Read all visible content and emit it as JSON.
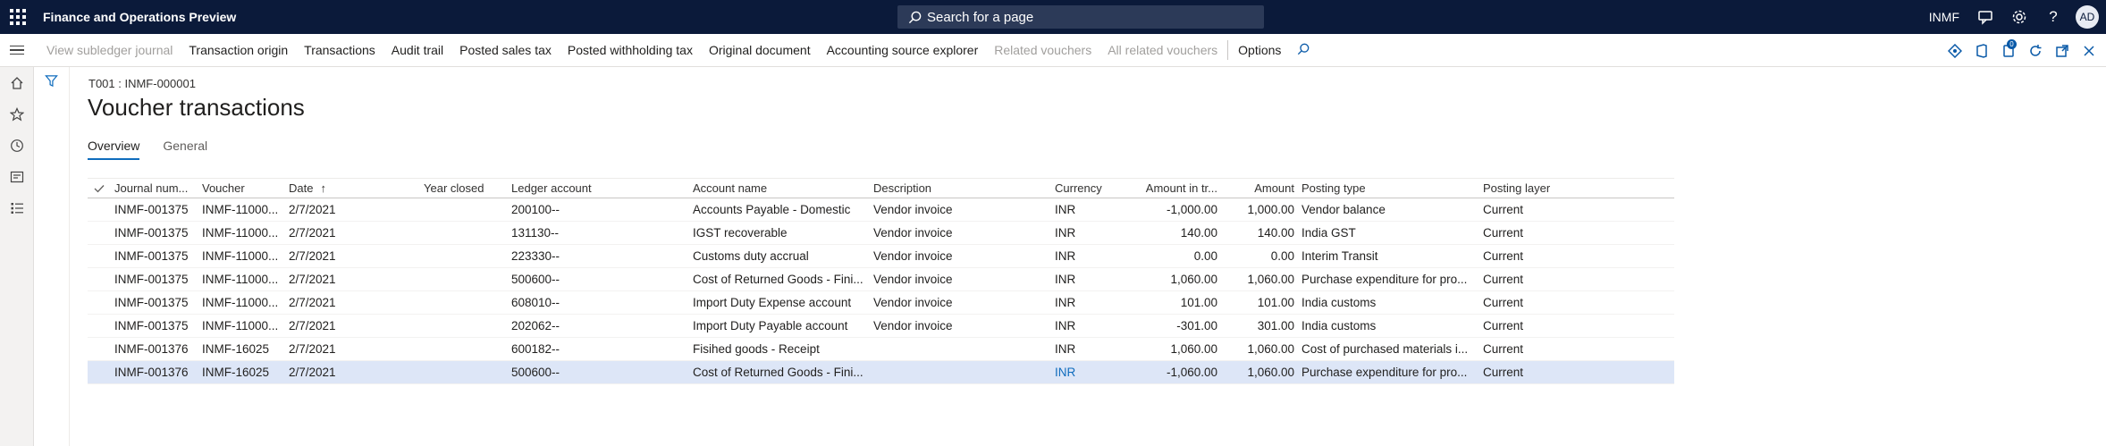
{
  "app": {
    "title": "Finance and Operations Preview",
    "search_placeholder": "Search for a page",
    "company": "INMF",
    "user_initials": "AD"
  },
  "actions": {
    "items": [
      {
        "label": "View subledger journal",
        "disabled": true
      },
      {
        "label": "Transaction origin",
        "disabled": false
      },
      {
        "label": "Transactions",
        "disabled": false
      },
      {
        "label": "Audit trail",
        "disabled": false
      },
      {
        "label": "Posted sales tax",
        "disabled": false
      },
      {
        "label": "Posted withholding tax",
        "disabled": false
      },
      {
        "label": "Original document",
        "disabled": false
      },
      {
        "label": "Accounting source explorer",
        "disabled": false
      },
      {
        "label": "Related vouchers",
        "disabled": true
      },
      {
        "label": "All related vouchers",
        "disabled": true
      }
    ],
    "options_label": "Options",
    "badge_count": "0"
  },
  "page": {
    "caption": "T001 : INMF-000001",
    "title": "Voucher transactions",
    "tabs": [
      "Overview",
      "General"
    ]
  },
  "grid": {
    "headers": {
      "journal": "Journal num...",
      "voucher": "Voucher",
      "date": "Date",
      "year_closed": "Year closed",
      "ledger": "Ledger account",
      "account_name": "Account name",
      "description": "Description",
      "currency": "Currency",
      "amount_tr": "Amount in tr...",
      "amount": "Amount",
      "posting_type": "Posting type",
      "posting_layer": "Posting layer"
    },
    "rows": [
      {
        "journal": "INMF-001375",
        "voucher": "INMF-11000...",
        "date": "2/7/2021",
        "year": "",
        "ledger": "200100--",
        "account": "Accounts Payable - Domestic",
        "desc": "Vendor invoice",
        "currency": "INR",
        "amt_tr": "-1,000.00",
        "amount": "1,000.00",
        "posting": "Vendor balance",
        "layer": "Current"
      },
      {
        "journal": "INMF-001375",
        "voucher": "INMF-11000...",
        "date": "2/7/2021",
        "year": "",
        "ledger": "131130--",
        "account": "IGST recoverable",
        "desc": "Vendor invoice",
        "currency": "INR",
        "amt_tr": "140.00",
        "amount": "140.00",
        "posting": "India GST",
        "layer": "Current"
      },
      {
        "journal": "INMF-001375",
        "voucher": "INMF-11000...",
        "date": "2/7/2021",
        "year": "",
        "ledger": "223330--",
        "account": "Customs duty accrual",
        "desc": "Vendor invoice",
        "currency": "INR",
        "amt_tr": "0.00",
        "amount": "0.00",
        "posting": "Interim Transit",
        "layer": "Current"
      },
      {
        "journal": "INMF-001375",
        "voucher": "INMF-11000...",
        "date": "2/7/2021",
        "year": "",
        "ledger": "500600--",
        "account": "Cost of Returned Goods - Fini...",
        "desc": "Vendor invoice",
        "currency": "INR",
        "amt_tr": "1,060.00",
        "amount": "1,060.00",
        "posting": "Purchase expenditure for pro...",
        "layer": "Current"
      },
      {
        "journal": "INMF-001375",
        "voucher": "INMF-11000...",
        "date": "2/7/2021",
        "year": "",
        "ledger": "608010--",
        "account": "Import Duty Expense account",
        "desc": "Vendor invoice",
        "currency": "INR",
        "amt_tr": "101.00",
        "amount": "101.00",
        "posting": "India customs",
        "layer": "Current"
      },
      {
        "journal": "INMF-001375",
        "voucher": "INMF-11000...",
        "date": "2/7/2021",
        "year": "",
        "ledger": "202062--",
        "account": "Import Duty Payable account",
        "desc": "Vendor invoice",
        "currency": "INR",
        "amt_tr": "-301.00",
        "amount": "301.00",
        "posting": "India customs",
        "layer": "Current"
      },
      {
        "journal": "INMF-001376",
        "voucher": "INMF-16025",
        "date": "2/7/2021",
        "year": "",
        "ledger": "600182--",
        "account": "Fisihed goods - Receipt",
        "desc": "",
        "currency": "INR",
        "amt_tr": "1,060.00",
        "amount": "1,060.00",
        "posting": "Cost of purchased materials i...",
        "layer": "Current"
      },
      {
        "journal": "INMF-001376",
        "voucher": "INMF-16025",
        "date": "2/7/2021",
        "year": "",
        "ledger": "500600--",
        "account": "Cost of Returned Goods - Fini...",
        "desc": "",
        "currency": "INR",
        "amt_tr": "-1,060.00",
        "amount": "1,060.00",
        "posting": "Purchase expenditure for pro...",
        "layer": "Current",
        "selected": true
      }
    ]
  }
}
